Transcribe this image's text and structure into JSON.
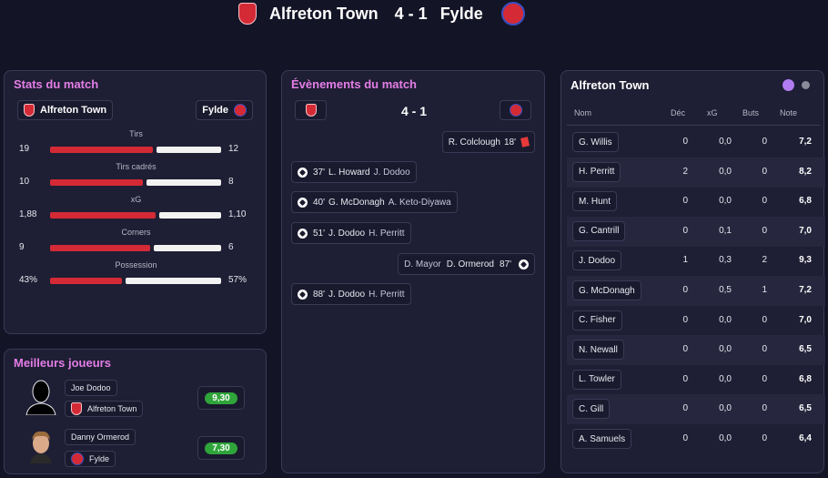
{
  "header": {
    "home_team": "Alfreton Town",
    "score": "4 - 1",
    "away_team": "Fylde"
  },
  "stats": {
    "title": "Stats du match",
    "home_team": "Alfreton Town",
    "away_team": "Fylde",
    "rows": [
      {
        "label": "Tirs",
        "home": "19",
        "away": "12",
        "home_share": 0.613
      },
      {
        "label": "Tirs cadrés",
        "home": "10",
        "away": "8",
        "home_share": 0.556
      },
      {
        "label": "xG",
        "home": "1,88",
        "away": "1,10",
        "home_share": 0.631
      },
      {
        "label": "Corners",
        "home": "9",
        "away": "6",
        "home_share": 0.6
      },
      {
        "label": "Possession",
        "home": "43%",
        "away": "57%",
        "home_share": 0.43
      }
    ]
  },
  "best": {
    "title": "Meilleurs joueurs",
    "players": [
      {
        "name": "Joe Dodoo",
        "team": "Alfreton Town",
        "rating": "9,30"
      },
      {
        "name": "Danny Ormerod",
        "team": "Fylde",
        "rating": "7,30"
      }
    ]
  },
  "events": {
    "title": "Évènements du match",
    "score": "4 - 1",
    "list": [
      {
        "side": "away",
        "type": "red-card",
        "player": "R. Colclough",
        "minute": "18'"
      },
      {
        "side": "home",
        "type": "goal",
        "minute": "37'",
        "player": "L. Howard",
        "assist": "J. Dodoo"
      },
      {
        "side": "home",
        "type": "goal",
        "minute": "40'",
        "player": "G. McDonagh",
        "assist": "A. Keto-Diyawa"
      },
      {
        "side": "home",
        "type": "goal",
        "minute": "51'",
        "player": "J. Dodoo",
        "assist": "H. Perritt"
      },
      {
        "side": "away",
        "type": "goal",
        "assist": "D. Mayor",
        "player": "D. Ormerod",
        "minute": "87'"
      },
      {
        "side": "home",
        "type": "goal",
        "minute": "88'",
        "player": "J. Dodoo",
        "assist": "H. Perritt"
      }
    ]
  },
  "team_table": {
    "title": "Alfreton Town",
    "headers": {
      "name": "Nom",
      "dec": "Déc",
      "xg": "xG",
      "buts": "Buts",
      "note": "Note"
    },
    "rows": [
      {
        "name": "G. Willis",
        "dec": "0",
        "xg": "0,0",
        "buts": "0",
        "note": "7,2"
      },
      {
        "name": "H. Perritt",
        "dec": "2",
        "xg": "0,0",
        "buts": "0",
        "note": "8,2"
      },
      {
        "name": "M. Hunt",
        "dec": "0",
        "xg": "0,0",
        "buts": "0",
        "note": "6,8"
      },
      {
        "name": "G. Cantrill",
        "dec": "0",
        "xg": "0,1",
        "buts": "0",
        "note": "7,0"
      },
      {
        "name": "J. Dodoo",
        "dec": "1",
        "xg": "0,3",
        "buts": "2",
        "note": "9,3"
      },
      {
        "name": "G. McDonagh",
        "dec": "0",
        "xg": "0,5",
        "buts": "1",
        "note": "7,2"
      },
      {
        "name": "C. Fisher",
        "dec": "0",
        "xg": "0,0",
        "buts": "0",
        "note": "7,0"
      },
      {
        "name": "N. Newall",
        "dec": "0",
        "xg": "0,0",
        "buts": "0",
        "note": "6,5"
      },
      {
        "name": "L. Towler",
        "dec": "0",
        "xg": "0,0",
        "buts": "0",
        "note": "6,8"
      },
      {
        "name": "C. Gill",
        "dec": "0",
        "xg": "0,0",
        "buts": "0",
        "note": "6,5"
      },
      {
        "name": "A. Samuels",
        "dec": "0",
        "xg": "0,0",
        "buts": "0",
        "note": "6,4"
      }
    ]
  },
  "colors": {
    "accent_pink": "#e47ee6",
    "home_bar": "#d42a36",
    "away_bar": "#f2f2f2",
    "rating_green": "#2fa43a",
    "toggle_active": "#b07cf0",
    "toggle_inactive": "#8a8a9a"
  }
}
